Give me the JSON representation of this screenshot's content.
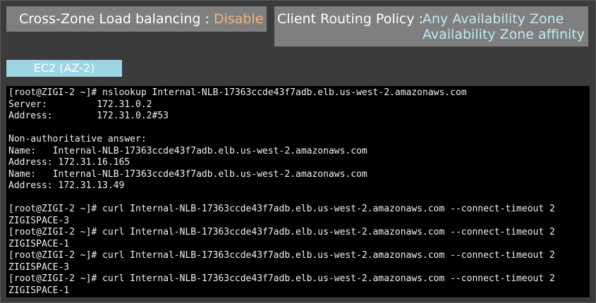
{
  "header": {
    "cross_zone": {
      "label": "Cross-Zone Load balancing : ",
      "value": "Disable",
      "value_color": "#f3b37d"
    },
    "routing": {
      "label": "Client Routing Policy : ",
      "options": [
        "Any Availability Zone",
        "Availability Zone affinity"
      ],
      "option_color": "#bfeaf6"
    }
  },
  "ec2_tag": {
    "label": "EC2 (AZ-2)",
    "color": "#9dd5e2"
  },
  "terminal": {
    "lines": [
      "[root@ZIGI-2 ~]# nslookup Internal-NLB-17363ccde43f7adb.elb.us-west-2.amazonaws.com",
      "Server:         172.31.0.2",
      "Address:        172.31.0.2#53",
      "",
      "Non-authoritative answer:",
      "Name:   Internal-NLB-17363ccde43f7adb.elb.us-west-2.amazonaws.com",
      "Address: 172.31.16.165",
      "Name:   Internal-NLB-17363ccde43f7adb.elb.us-west-2.amazonaws.com",
      "Address: 172.31.13.49",
      "",
      "[root@ZIGI-2 ~]# curl Internal-NLB-17363ccde43f7adb.elb.us-west-2.amazonaws.com --connect-timeout 2",
      "ZIGISPACE-3",
      "[root@ZIGI-2 ~]# curl Internal-NLB-17363ccde43f7adb.elb.us-west-2.amazonaws.com --connect-timeout 2",
      "ZIGISPACE-1",
      "[root@ZIGI-2 ~]# curl Internal-NLB-17363ccde43f7adb.elb.us-west-2.amazonaws.com --connect-timeout 2",
      "ZIGISPACE-3",
      "[root@ZIGI-2 ~]# curl Internal-NLB-17363ccde43f7adb.elb.us-west-2.amazonaws.com --connect-timeout 2",
      "ZIGISPACE-1"
    ]
  }
}
